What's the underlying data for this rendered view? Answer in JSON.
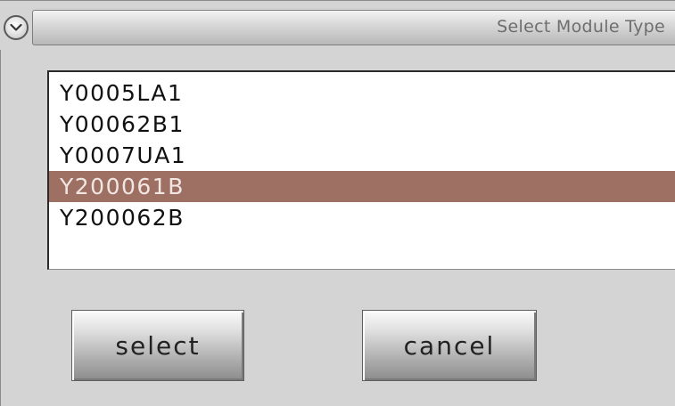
{
  "dialog": {
    "title": "Select Module Type"
  },
  "module_list": {
    "items": [
      {
        "label": "Y0005LA1",
        "selected": false
      },
      {
        "label": "Y00062B1",
        "selected": false
      },
      {
        "label": "Y0007UA1",
        "selected": false
      },
      {
        "label": "Y200061B",
        "selected": true
      },
      {
        "label": "Y200062B",
        "selected": false
      }
    ],
    "selected_color": "#9e6f63"
  },
  "buttons": {
    "select_label": "select",
    "cancel_label": "cancel"
  },
  "icons": {
    "collapse": "chevron-down-icon"
  }
}
